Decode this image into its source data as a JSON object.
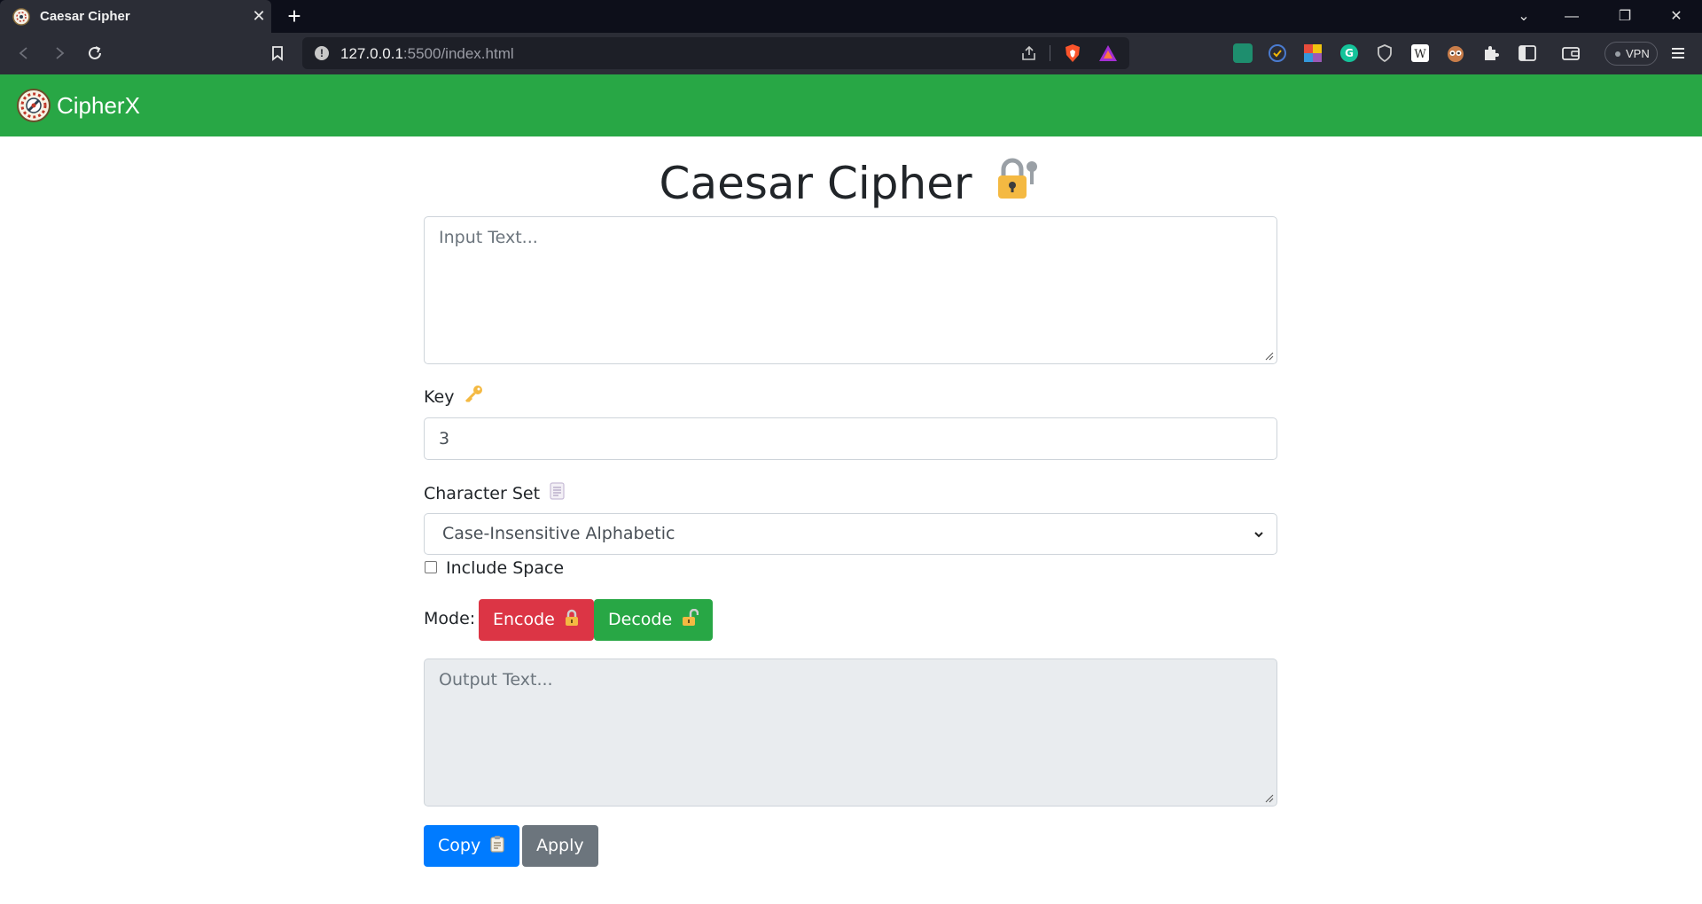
{
  "browser": {
    "tab_title": "Caesar Cipher",
    "url_host": "127.0.0.1",
    "url_rest": ":5500/index.html",
    "vpn_label": "VPN"
  },
  "navbar": {
    "brand": "CipherX"
  },
  "page": {
    "title": "Caesar Cipher"
  },
  "form": {
    "input_placeholder": "Input Text...",
    "key_label": "Key",
    "key_value": "3",
    "charset_label": "Character Set",
    "charset_selected": "Case-Insensitive Alphabetic",
    "include_space_label": "Include Space",
    "include_space_checked": false,
    "mode_label": "Mode:",
    "encode_label": "Encode",
    "decode_label": "Decode",
    "output_placeholder": "Output Text...",
    "copy_label": "Copy",
    "apply_label": "Apply"
  },
  "colors": {
    "navbar": "#28a745",
    "encode": "#dc3545",
    "decode": "#28a745",
    "copy": "#007bff",
    "apply": "#6c757d"
  }
}
